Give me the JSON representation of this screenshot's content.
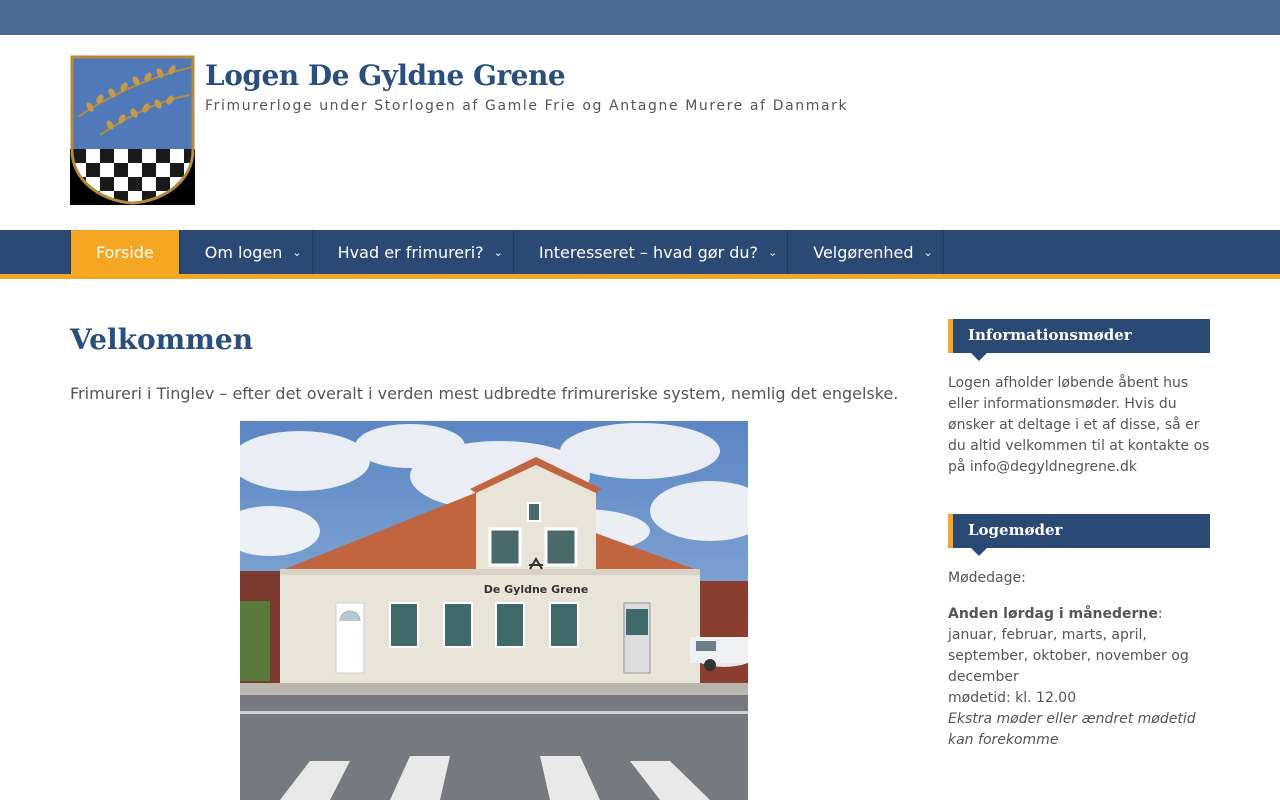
{
  "header": {
    "site_title": "Logen De Gyldne Grene",
    "tagline": "Frimurerloge under Storlogen af Gamle Frie og Antagne Murere af Danmark",
    "logo_icon": "coat-of-arms-branch-checkered-logo"
  },
  "nav": {
    "items": [
      {
        "label": "Forside",
        "active": true,
        "has_dropdown": false
      },
      {
        "label": "Om logen",
        "active": false,
        "has_dropdown": true
      },
      {
        "label": "Hvad er frimureri?",
        "active": false,
        "has_dropdown": true
      },
      {
        "label": "Interesseret – hvad gør du?",
        "active": false,
        "has_dropdown": true
      },
      {
        "label": "Velgørenhed",
        "active": false,
        "has_dropdown": true
      }
    ],
    "dropdown_icon": "chevron-down-icon"
  },
  "main": {
    "title": "Velkommen",
    "intro": "Frimureri i Tinglev – efter det overalt i verden mest udbredte frimureriske system, nemlig det engelske.",
    "photo_sign": "De Gyldne Grene"
  },
  "sidebar": {
    "info_widget": {
      "title": "Informationsmøder",
      "text": "Logen afholder løbende åbent hus eller informationsmøder. Hvis du ønsker at deltage i et af disse, så er du altid velkommen til at kontakte os på info@degyldnegrene.dk"
    },
    "meetings_widget": {
      "title": "Logemøder",
      "days_label": "Mødedage:",
      "bold_label": "Anden lørdag i månederne",
      "colon": ":",
      "months": "januar, februar, marts, april, september, oktober,  november og december",
      "time": "mødetid: kl. 12.00",
      "note": "Ekstra møder eller ændret mødetid kan forekomme"
    }
  },
  "colors": {
    "top_strip": "#4a6a93",
    "nav_bg": "#2a4a75",
    "accent": "#f5a623",
    "title": "#2a4f7c"
  }
}
